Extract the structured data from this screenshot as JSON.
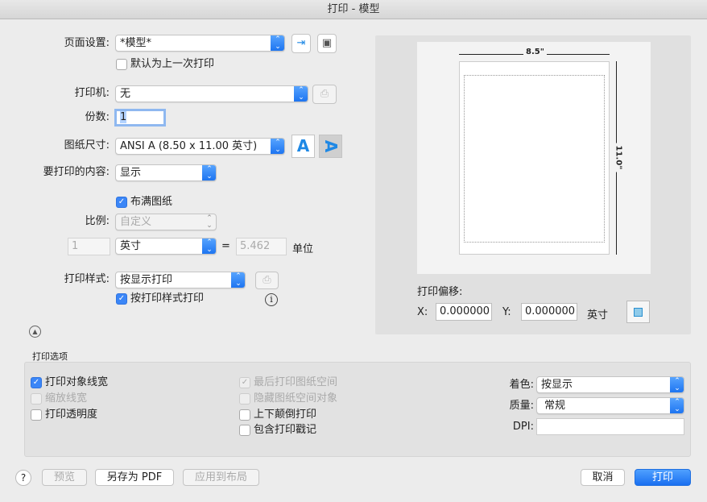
{
  "window": {
    "title": "打印 - 模型"
  },
  "page_setup": {
    "label": "页面设置:",
    "value": "*模型*",
    "default_last": "默认为上一次打印"
  },
  "printer": {
    "label": "打印机:",
    "value": "无"
  },
  "copies": {
    "label": "份数:",
    "value": "1"
  },
  "paper_size": {
    "label": "图纸尺寸:",
    "value": "ANSI A (8.50 x 11.00 英寸)"
  },
  "what_to_print": {
    "label": "要打印的内容:",
    "value": "显示"
  },
  "fit_to_paper": {
    "label": "布满图纸",
    "checked": true
  },
  "scale": {
    "label": "比例:",
    "value": "自定义",
    "units_value": "1",
    "unit": "英寸",
    "equals": "=",
    "drawing_units": "5.462",
    "drawing_units_label": "单位"
  },
  "plot_style": {
    "label": "打印样式:",
    "value": "按显示打印",
    "by_style_label": "按打印样式打印",
    "by_style_checked": true
  },
  "preview": {
    "width_label": "8.5\"",
    "height_label": "11.0\""
  },
  "offset": {
    "label": "打印偏移:",
    "x_label": "X:",
    "x_value": "0.000000",
    "y_label": "Y:",
    "y_value": "0.000000",
    "unit": "英寸"
  },
  "options": {
    "title": "打印选项",
    "left": [
      {
        "label": "打印对象线宽",
        "checked": true,
        "disabled": false
      },
      {
        "label": "缩放线宽",
        "checked": false,
        "disabled": true
      },
      {
        "label": "打印透明度",
        "checked": false,
        "disabled": false
      }
    ],
    "middle": [
      {
        "label": "最后打印图纸空间",
        "checked": true,
        "disabled": true
      },
      {
        "label": "隐藏图纸空间对象",
        "checked": false,
        "disabled": true
      },
      {
        "label": "上下颠倒打印",
        "checked": false,
        "disabled": false
      },
      {
        "label": "包含打印戳记",
        "checked": false,
        "disabled": false
      }
    ],
    "shading_label": "着色:",
    "shading_value": "按显示",
    "quality_label": "质量:",
    "quality_value": "常规",
    "dpi_label": "DPI:",
    "dpi_value": ""
  },
  "footer": {
    "help": "?",
    "preview": "预览",
    "save_pdf": "另存为 PDF",
    "apply_layout": "应用到布局",
    "cancel": "取消",
    "print": "打印"
  }
}
